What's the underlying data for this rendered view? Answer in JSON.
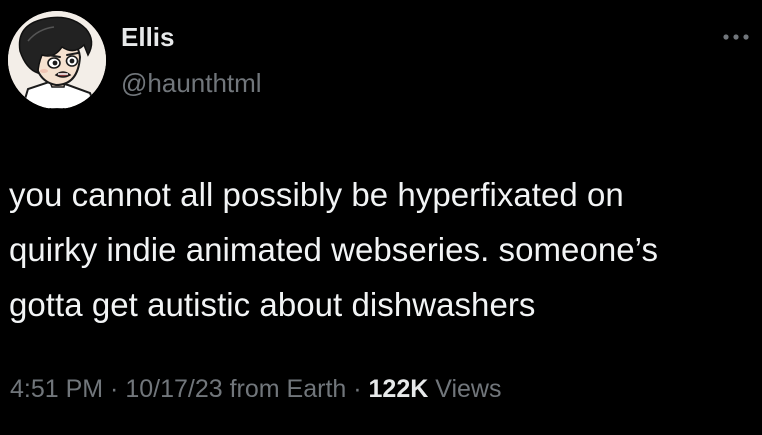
{
  "author": {
    "display_name": "Ellis",
    "handle": "@haunthtml"
  },
  "more_menu_icon": "ellipsis-icon",
  "tweet": {
    "text": "you cannot all possibly be hyperfixated on\nquirky indie animated webseries. someone’s\ngotta get autistic about dishwashers"
  },
  "meta": {
    "time": "4:51 PM",
    "separator1": " · ",
    "date": "10/17/23",
    "source": " from Earth",
    "separator2": " · ",
    "views_count": "122K",
    "views_label": " Views"
  },
  "colors": {
    "background": "#000000",
    "primary_text": "#e7e9ea",
    "secondary_text": "#71767b"
  }
}
